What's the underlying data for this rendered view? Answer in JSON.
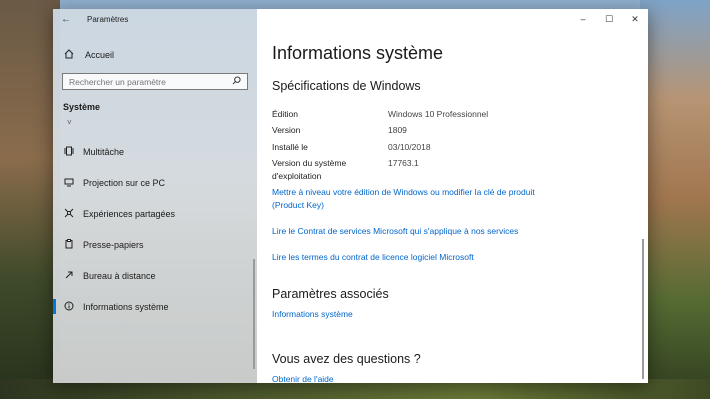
{
  "window": {
    "app_title": "Paramètres",
    "controls": {
      "minimize": "–",
      "maximize": "☐",
      "close": "✕"
    }
  },
  "sidebar": {
    "back_glyph": "←",
    "home_label": "Accueil",
    "search_placeholder": "Rechercher un paramètre",
    "section_label": "Système",
    "collapse_glyph": "˅",
    "items": [
      {
        "label": "Multitâche",
        "icon": "multitasking-icon"
      },
      {
        "label": "Projection sur ce PC",
        "icon": "projection-icon"
      },
      {
        "label": "Expériences partagées",
        "icon": "shared-experiences-icon"
      },
      {
        "label": "Presse-papiers",
        "icon": "clipboard-icon"
      },
      {
        "label": "Bureau à distance",
        "icon": "remote-desktop-icon"
      },
      {
        "label": "Informations système",
        "icon": "info-icon",
        "active": true
      }
    ]
  },
  "main": {
    "title": "Informations système",
    "specs_heading": "Spécifications de Windows",
    "specs": [
      {
        "key": "Édition",
        "value": "Windows 10 Professionnel"
      },
      {
        "key": "Version",
        "value": "1809"
      },
      {
        "key": "Installé le",
        "value": "03/10/2018"
      },
      {
        "key": "Version du système d'exploitation",
        "value": "17763.1"
      }
    ],
    "links": [
      "Mettre à niveau votre édition de Windows ou modifier la clé de produit (Product Key)",
      "Lire le Contrat de services Microsoft qui s'applique à nos services",
      "Lire les termes du contrat de licence logiciel Microsoft"
    ],
    "related_heading": "Paramètres associés",
    "related_link": "Informations système",
    "questions_heading": "Vous avez des questions ?",
    "help_link": "Obtenir de l'aide"
  },
  "colors": {
    "accent": "#0078d7",
    "link": "#0066cc"
  }
}
